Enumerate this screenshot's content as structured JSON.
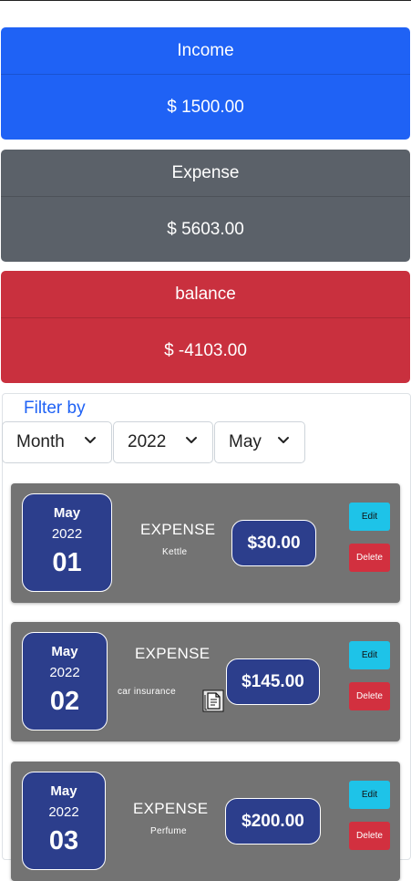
{
  "summary": {
    "income": {
      "label": "Income",
      "value": "$ 1500.00"
    },
    "expense": {
      "label": "Expense",
      "value": "$ 5603.00"
    },
    "balance": {
      "label": "balance",
      "value": "$ -4103.00"
    }
  },
  "filter": {
    "title": "Filter by",
    "period": "Month",
    "year": "2022",
    "month": "May"
  },
  "transactions": [
    {
      "month": "May",
      "year": "2022",
      "day": "01",
      "type": "EXPENSE",
      "description": "Kettle",
      "amount": "$30.00",
      "edit_label": "Edit",
      "delete_label": "Delete"
    },
    {
      "month": "May",
      "year": "2022",
      "day": "02",
      "type": "EXPENSE",
      "description": "car insurance",
      "amount": "$145.00",
      "edit_label": "Edit",
      "delete_label": "Delete",
      "attachment_icon": "document-icon"
    },
    {
      "month": "May",
      "year": "2022",
      "day": "03",
      "type": "EXPENSE",
      "description": "Perfume",
      "amount": "$200.00",
      "edit_label": "Edit",
      "delete_label": "Delete"
    }
  ],
  "colors": {
    "income": "#1f62f5",
    "expense": "#5b6169",
    "balance": "#c9303e",
    "card_bg": "#737373",
    "date_box": "#2c3e8c",
    "edit_button": "#1ec3e8",
    "delete_button": "#d2303f"
  }
}
